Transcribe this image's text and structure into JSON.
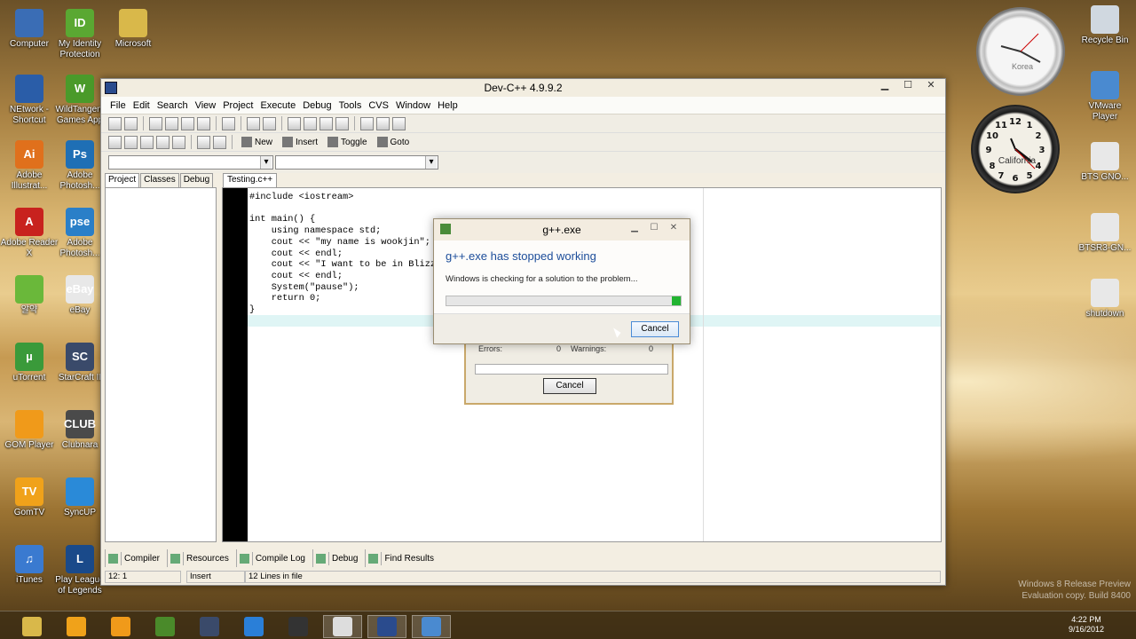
{
  "desktop_icons": [
    {
      "label": "Computer",
      "icon": "computer-icon",
      "color": "#3a6db5",
      "glyph": ""
    },
    {
      "label": "My Identity Protection",
      "icon": "identity-icon",
      "color": "#5aa832",
      "glyph": "ID"
    },
    {
      "label": "Microsoft",
      "icon": "folder-icon",
      "color": "#d9b84a",
      "glyph": ""
    },
    {
      "label": "NEtwork - Shortcut",
      "icon": "network-icon",
      "color": "#2a5da8",
      "glyph": ""
    },
    {
      "label": "WildTangent Games App",
      "icon": "wildtangent-icon",
      "color": "#4a9a2a",
      "glyph": "W"
    },
    {
      "label": "Adobe Illustrat...",
      "icon": "illustrator-icon",
      "color": "#e0701c",
      "glyph": "Ai"
    },
    {
      "label": "Adobe Photosh...",
      "icon": "photoshop-icon",
      "color": "#1f6fb5",
      "glyph": "Ps"
    },
    {
      "label": "Adobe Reader X",
      "icon": "reader-icon",
      "color": "#c8221e",
      "glyph": "A"
    },
    {
      "label": "Adobe Photosh...",
      "icon": "photoshop-elements-icon",
      "color": "#2a7fc8",
      "glyph": "pse"
    },
    {
      "label": "알약",
      "icon": "alyac-icon",
      "color": "#6ab83a",
      "glyph": ""
    },
    {
      "label": "eBay",
      "icon": "ebay-icon",
      "color": "#e8e8e8",
      "glyph": "eBay"
    },
    {
      "label": "uTorrent",
      "icon": "utorrent-icon",
      "color": "#3a9a3a",
      "glyph": "µ"
    },
    {
      "label": "StarCraft II",
      "icon": "starcraft-icon",
      "color": "#3a4a6a",
      "glyph": "SC"
    },
    {
      "label": "GOM Player",
      "icon": "gom-player-icon",
      "color": "#f09a1a",
      "glyph": ""
    },
    {
      "label": "Clubnara",
      "icon": "clubnara-icon",
      "color": "#4a4a4a",
      "glyph": "CLUB"
    },
    {
      "label": "GomTV",
      "icon": "gomtv-icon",
      "color": "#f0a21a",
      "glyph": "TV"
    },
    {
      "label": "SyncUP",
      "icon": "syncup-icon",
      "color": "#2a8ad8",
      "glyph": ""
    },
    {
      "label": "iTunes",
      "icon": "itunes-icon",
      "color": "#3a7ad0",
      "glyph": "♫"
    },
    {
      "label": "Play League of Legends",
      "icon": "league-icon",
      "color": "#1a4a8a",
      "glyph": "L"
    },
    {
      "label": "Recycle Bin",
      "icon": "recycle-bin-icon",
      "color": "#d0d8e0",
      "glyph": ""
    },
    {
      "label": "VMware Player",
      "icon": "vmware-icon",
      "color": "#4a8ad0",
      "glyph": ""
    },
    {
      "label": "BTS GNO...",
      "icon": "file-icon",
      "color": "#e8e8e8",
      "glyph": ""
    },
    {
      "label": "BTSR3-GN...",
      "icon": "file-icon",
      "color": "#e8e8e8",
      "glyph": ""
    },
    {
      "label": "shutdown",
      "icon": "shutdown-icon",
      "color": "#e8e8e8",
      "glyph": ""
    }
  ],
  "gadgets": {
    "clock1_label": "Korea",
    "clock2_label": "California"
  },
  "window": {
    "title": "Dev-C++ 4.9.9.2",
    "menu": [
      "File",
      "Edit",
      "Search",
      "View",
      "Project",
      "Execute",
      "Debug",
      "Tools",
      "CVS",
      "Window",
      "Help"
    ],
    "toolbar_labels": {
      "new": "New",
      "insert": "Insert",
      "toggle": "Toggle",
      "goto": "Goto"
    },
    "left_tabs": [
      "Project",
      "Classes",
      "Debug"
    ],
    "editor_tab": "Testing.c++",
    "code": "#include <iostream>\n\nint main() {\n    using namespace std;\n    cout << \"my name is wookjin\";\n    cout << endl;\n    cout << \"I want to be in Blizzard\";\n    cout << endl;\n    System(\"pause\");\n    return 0;\n}",
    "bottom_tabs": [
      "Compiler",
      "Resources",
      "Compile Log",
      "Debug",
      "Find Results"
    ],
    "status": {
      "position": "12: 1",
      "mode": "Insert",
      "lines": "12 Lines in file"
    }
  },
  "compile_dialog": {
    "errors_label": "Errors:",
    "errors_value": "0",
    "warnings_label": "Warnings:",
    "warnings_value": "0",
    "cancel_label": "Cancel"
  },
  "error_dialog": {
    "title": "g++.exe",
    "heading": "g++.exe has stopped working",
    "message": "Windows is checking for a solution to the problem...",
    "cancel_label": "Cancel"
  },
  "taskbar": {
    "time": "4:22 PM",
    "date": "9/16/2012",
    "items": [
      "explorer",
      "media-player",
      "gom",
      "dreamweaver",
      "starcraft",
      "internet-explorer",
      "steam",
      "window",
      "dev-cpp",
      "vmware"
    ]
  },
  "watermark": [
    "Windows 8 Release Preview",
    "Evaluation copy. Build 8400"
  ]
}
